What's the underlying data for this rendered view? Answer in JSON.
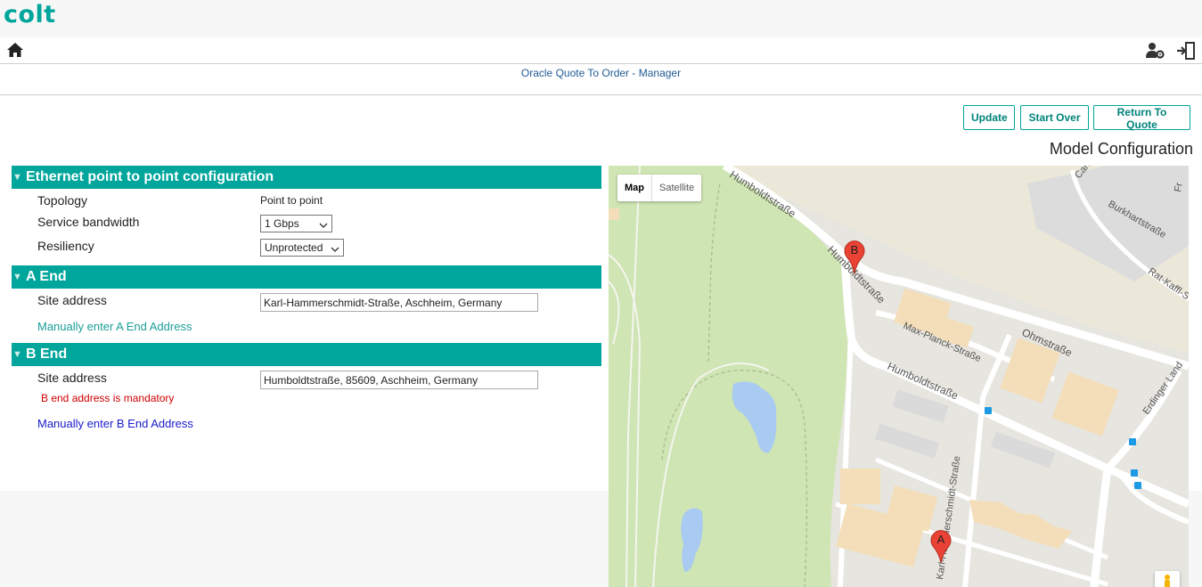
{
  "brand": {
    "logo_text": "colt",
    "accent": "#00a59b"
  },
  "nav": {
    "icons": [
      "home-icon",
      "user-settings-icon",
      "logout-icon"
    ]
  },
  "app_title": "Oracle Quote To Order - Manager",
  "actions": {
    "update": "Update",
    "start_over": "Start Over",
    "return_to_quote": "Return To Quote"
  },
  "page_heading": "Model Configuration",
  "eth_section": {
    "title": "Ethernet point to point configuration",
    "topology_label": "Topology",
    "topology_value": "Point to point",
    "bandwidth_label": "Service bandwidth",
    "bandwidth_value": "1 Gbps",
    "resiliency_label": "Resiliency",
    "resiliency_value": "Unprotected"
  },
  "a_end": {
    "title": "A End",
    "site_label": "Site address",
    "site_value": "Karl-Hammerschmidt-Straße, Aschheim, Germany",
    "manual_link": "Manually enter A End Address"
  },
  "b_end": {
    "title": "B End",
    "site_label": "Site address",
    "site_value": "Humboldtstraße, 85609, Aschheim, Germany",
    "error": "B end address is mandatory",
    "manual_link": "Manually enter B End Address"
  },
  "map": {
    "type_map": "Map",
    "type_satellite": "Satellite",
    "marker_a": "A",
    "marker_b": "B",
    "streets": {
      "humboldt_top": "Humboldtstraße",
      "humboldt_side": "Humboldtstraße",
      "humboldt_mid": "Humboldtstraße",
      "max_planck": "Max-Planck-Straße",
      "ohm": "Ohmstraße",
      "karl": "Karl-Hammerschmidt-Straße",
      "burkhart": "Burkhartstraße",
      "rat_kaffl": "Rat-Kaffl-S",
      "erdinger": "Erdinger Land",
      "cari": "Cari",
      "fr": "Fr"
    }
  }
}
